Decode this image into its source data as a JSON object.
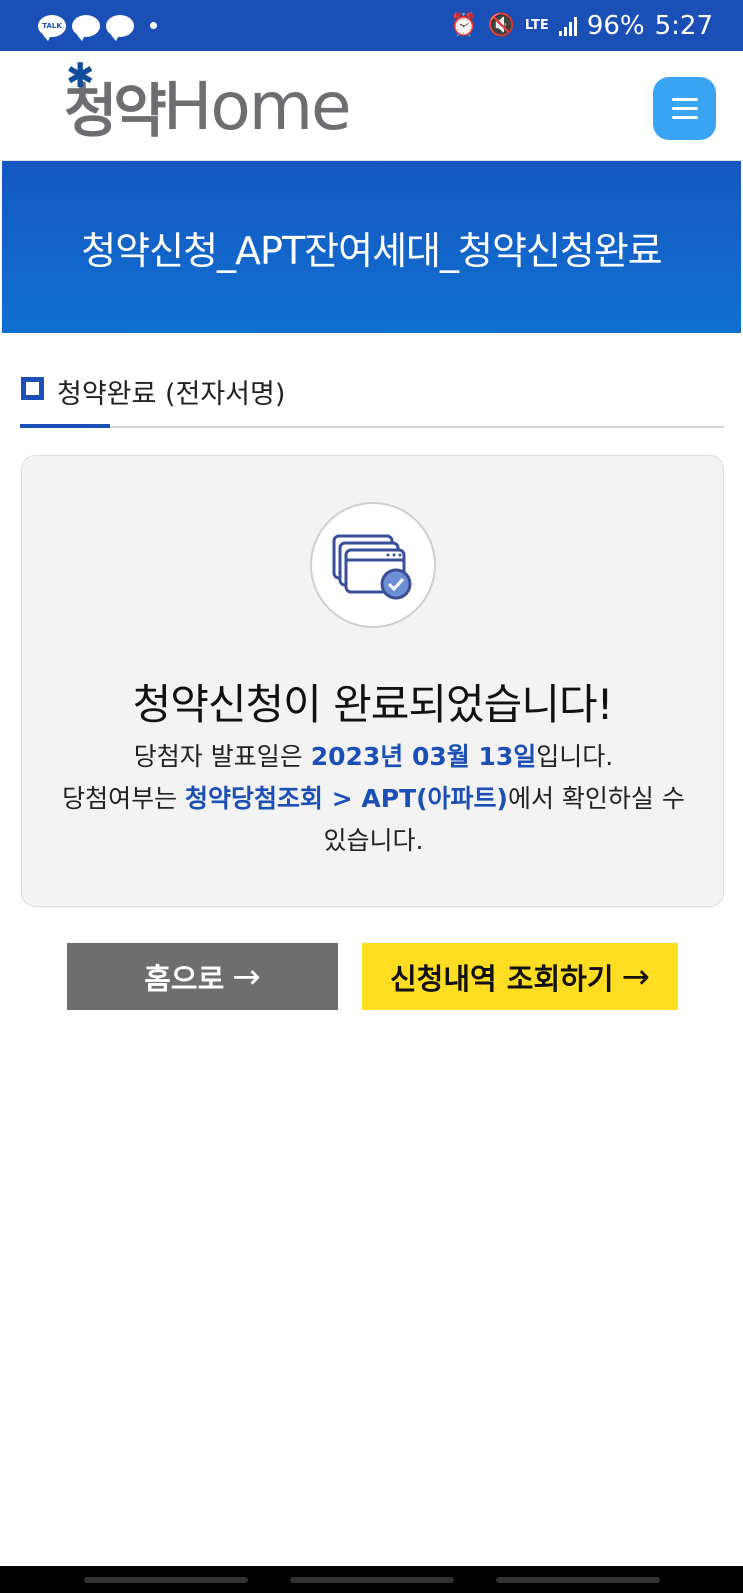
{
  "status_bar": {
    "talk_label": "TALK",
    "battery": "96%",
    "time": "5:27",
    "network": "LTE"
  },
  "header": {
    "logo_kr": "청약",
    "logo_en": "Home",
    "menu_icon": "hamburger-icon"
  },
  "banner": {
    "title": "청약신청_APT잔여세대_청약신청완료"
  },
  "section": {
    "title": "청약완료 (전자서명)"
  },
  "card": {
    "heading": "청약신청이 완료되었습니다!",
    "line1_prefix": "당첨자 발표일은 ",
    "announce_date": "2023년 03월 13일",
    "line1_suffix": "입니다.",
    "line2_prefix": "당첨여부는 ",
    "check_path": "청약당첨조회 > APT(아파트)",
    "line2_suffix": "에서 확인하실 수 있습니다."
  },
  "buttons": {
    "home_label": "홈으로",
    "history_label": "신청내역 조회하기",
    "arrow_icon": "arrow-right-icon"
  },
  "colors": {
    "primary_blue": "#1a4fb5",
    "menu_blue": "#3aa4f2",
    "yellow": "#ffdd22",
    "gray_button": "#6e6e6e"
  }
}
